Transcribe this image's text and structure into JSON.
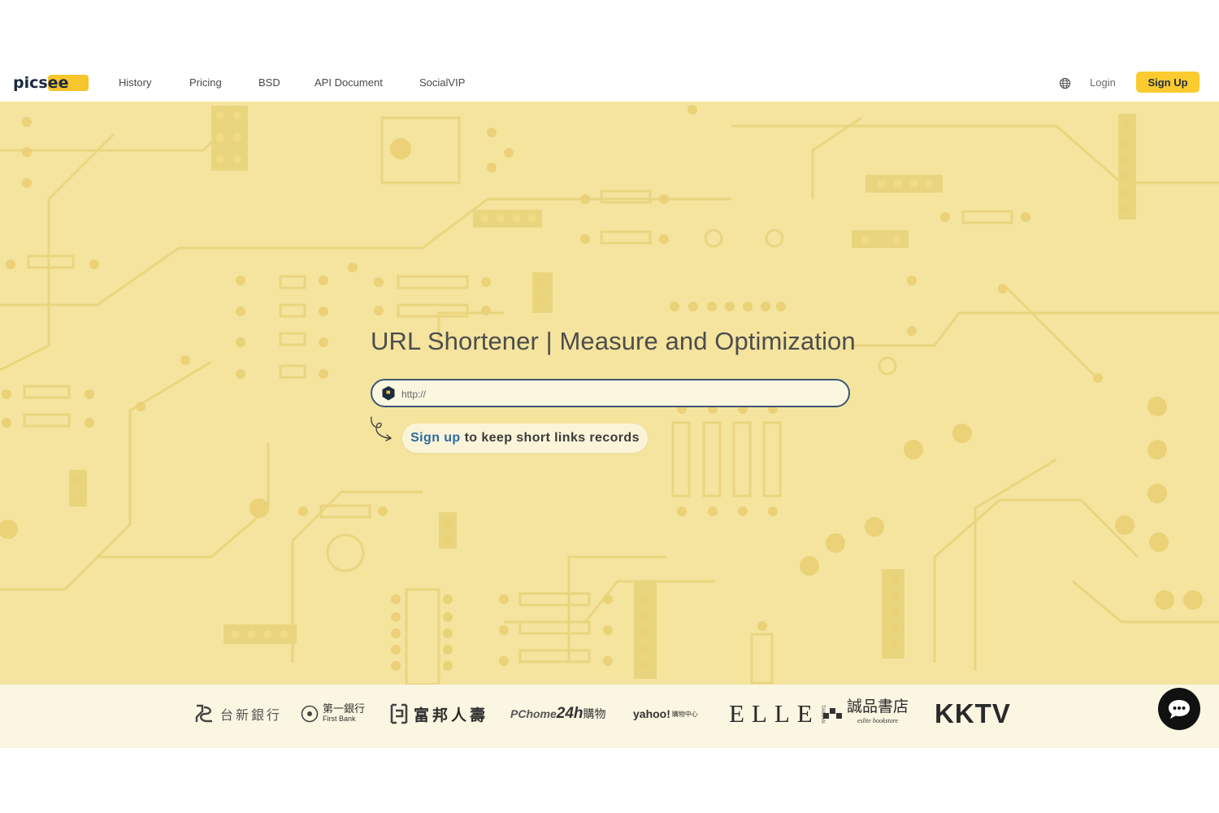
{
  "header": {
    "logo_text": "picsee",
    "nav": [
      "History",
      "Pricing",
      "BSD",
      "API Document",
      "SocialVIP"
    ],
    "login_label": "Login",
    "signup_label": "Sign Up",
    "language_icon": "globe-icon"
  },
  "hero": {
    "title": "URL Shortener | Measure and Optimization",
    "url_placeholder": "http://",
    "signup_link": "Sign up",
    "signup_rest": "to keep short links records"
  },
  "partners": [
    {
      "name": "台新銀行"
    },
    {
      "name": "第一銀行",
      "sub": "First Bank"
    },
    {
      "name": "富邦人壽"
    },
    {
      "name": "PChome",
      "extra": "24h",
      "suffix": "購物"
    },
    {
      "name": "yahoo!",
      "suffix": "購物中心"
    },
    {
      "name": "ELLE",
      "suffix": "TAIWAN"
    },
    {
      "name": "誠品書店",
      "sub": "eslite bookstore"
    },
    {
      "name": "KKTV"
    }
  ],
  "colors": {
    "hero_bg": "#f4e49e",
    "circuit": "#e8d27e",
    "accent_yellow": "#fccb2f",
    "navy": "#1f2d3d",
    "link_blue": "#2a6ba0",
    "strip_bg": "#fbf6e2"
  }
}
